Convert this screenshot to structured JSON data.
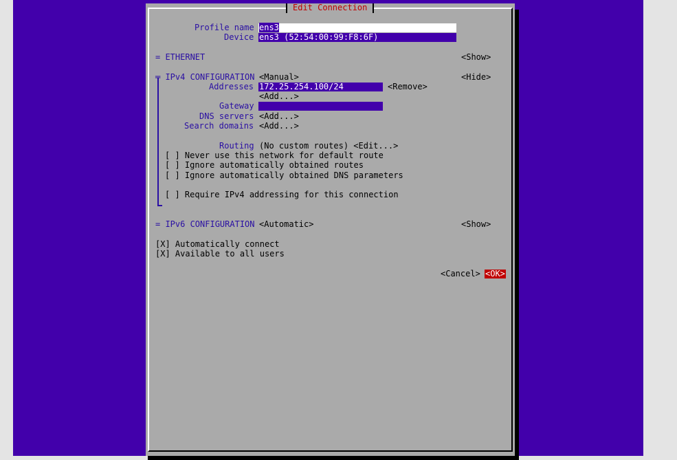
{
  "dialog": {
    "title": "Edit Connection"
  },
  "profile": {
    "name_label": "Profile name",
    "name_value": "ens3",
    "device_label": "Device",
    "device_value": "ens3 (52:54:00:99:F8:6F)"
  },
  "ethernet": {
    "label": "= ETHERNET",
    "toggle": "<Show>"
  },
  "ipv4": {
    "label": "╤ IPv4 CONFIGURATION",
    "mode": "<Manual>",
    "toggle": "<Hide>",
    "addresses_label": "Addresses",
    "address_value": "172.25.254.100/24",
    "remove": "<Remove>",
    "add_address": "<Add...>",
    "gateway_label": "Gateway",
    "gateway_value": "",
    "dns_label": "DNS servers",
    "dns_add": "<Add...>",
    "search_label": "Search domains",
    "search_add": "<Add...>",
    "routing_label": "Routing",
    "routing_value": "(No custom routes) <Edit...>",
    "check_never_default": "[ ] Never use this network for default route",
    "check_ignore_routes": "[ ] Ignore automatically obtained routes",
    "check_ignore_dns": "[ ] Ignore automatically obtained DNS parameters",
    "check_require_ipv4": "[ ] Require IPv4 addressing for this connection"
  },
  "ipv6": {
    "label": "= IPv6 CONFIGURATION",
    "mode": "<Automatic>",
    "toggle": "<Show>"
  },
  "options": {
    "auto_connect": "[X] Automatically connect",
    "all_users": "[X] Available to all users"
  },
  "buttons": {
    "cancel": "<Cancel>",
    "ok": "<OK>"
  },
  "colors": {
    "background": "#4200ab",
    "dialog": "#aaaaaa",
    "accent": "#c00000"
  }
}
